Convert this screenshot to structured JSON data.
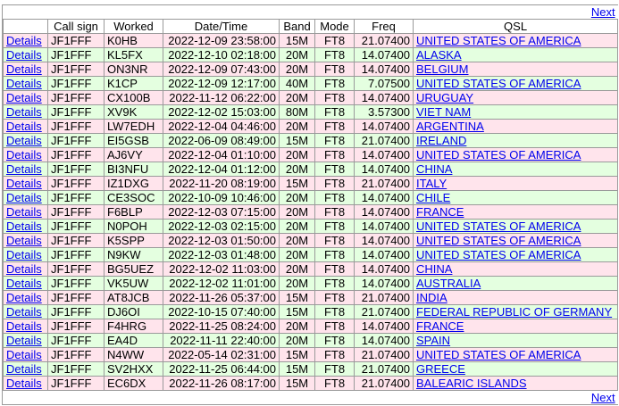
{
  "nav": {
    "next_label": "Next"
  },
  "columns": [
    "",
    "Call sign",
    "Worked",
    "Date/Time",
    "Band",
    "Mode",
    "Freq",
    "QSL"
  ],
  "details_label": "Details",
  "rows": [
    {
      "call": "JF1FFF",
      "worked": "K0HB",
      "datetime": "2022-12-09 23:58:00",
      "band": "15M",
      "mode": "FT8",
      "freq": "21.07400",
      "qsl": "UNITED STATES OF AMERICA"
    },
    {
      "call": "JF1FFF",
      "worked": "KL5FX",
      "datetime": "2022-12-10 02:18:00",
      "band": "20M",
      "mode": "FT8",
      "freq": "14.07400",
      "qsl": "ALASKA"
    },
    {
      "call": "JF1FFF",
      "worked": "ON3NR",
      "datetime": "2022-12-09 07:43:00",
      "band": "20M",
      "mode": "FT8",
      "freq": "14.07400",
      "qsl": "BELGIUM"
    },
    {
      "call": "JF1FFF",
      "worked": "K1CP",
      "datetime": "2022-12-09 12:17:00",
      "band": "40M",
      "mode": "FT8",
      "freq": "7.07500",
      "qsl": "UNITED STATES OF AMERICA"
    },
    {
      "call": "JF1FFF",
      "worked": "CX100B",
      "datetime": "2022-11-12 06:22:00",
      "band": "20M",
      "mode": "FT8",
      "freq": "14.07400",
      "qsl": "URUGUAY"
    },
    {
      "call": "JF1FFF",
      "worked": "XV9K",
      "datetime": "2022-12-02 15:03:00",
      "band": "80M",
      "mode": "FT8",
      "freq": "3.57300",
      "qsl": "VIET NAM"
    },
    {
      "call": "JF1FFF",
      "worked": "LW7EDH",
      "datetime": "2022-12-04 04:46:00",
      "band": "20M",
      "mode": "FT8",
      "freq": "14.07400",
      "qsl": "ARGENTINA"
    },
    {
      "call": "JF1FFF",
      "worked": "EI5GSB",
      "datetime": "2022-06-09 08:49:00",
      "band": "15M",
      "mode": "FT8",
      "freq": "21.07400",
      "qsl": "IRELAND"
    },
    {
      "call": "JF1FFF",
      "worked": "AJ6VY",
      "datetime": "2022-12-04 01:10:00",
      "band": "20M",
      "mode": "FT8",
      "freq": "14.07400",
      "qsl": "UNITED STATES OF AMERICA"
    },
    {
      "call": "JF1FFF",
      "worked": "BI3NFU",
      "datetime": "2022-12-04 01:12:00",
      "band": "20M",
      "mode": "FT8",
      "freq": "14.07400",
      "qsl": "CHINA"
    },
    {
      "call": "JF1FFF",
      "worked": "IZ1DXG",
      "datetime": "2022-11-20 08:19:00",
      "band": "15M",
      "mode": "FT8",
      "freq": "21.07400",
      "qsl": "ITALY"
    },
    {
      "call": "JF1FFF",
      "worked": "CE3SOC",
      "datetime": "2022-10-09 10:46:00",
      "band": "20M",
      "mode": "FT8",
      "freq": "14.07400",
      "qsl": "CHILE"
    },
    {
      "call": "JF1FFF",
      "worked": "F6BLP",
      "datetime": "2022-12-03 07:15:00",
      "band": "20M",
      "mode": "FT8",
      "freq": "14.07400",
      "qsl": "FRANCE"
    },
    {
      "call": "JF1FFF",
      "worked": "N0POH",
      "datetime": "2022-12-03 02:15:00",
      "band": "20M",
      "mode": "FT8",
      "freq": "14.07400",
      "qsl": "UNITED STATES OF AMERICA"
    },
    {
      "call": "JF1FFF",
      "worked": "K5SPP",
      "datetime": "2022-12-03 01:50:00",
      "band": "20M",
      "mode": "FT8",
      "freq": "14.07400",
      "qsl": "UNITED STATES OF AMERICA"
    },
    {
      "call": "JF1FFF",
      "worked": "N9KW",
      "datetime": "2022-12-03 01:48:00",
      "band": "20M",
      "mode": "FT8",
      "freq": "14.07400",
      "qsl": "UNITED STATES OF AMERICA"
    },
    {
      "call": "JF1FFF",
      "worked": "BG5UEZ",
      "datetime": "2022-12-02 11:03:00",
      "band": "20M",
      "mode": "FT8",
      "freq": "14.07400",
      "qsl": "CHINA"
    },
    {
      "call": "JF1FFF",
      "worked": "VK5UW",
      "datetime": "2022-12-02 11:01:00",
      "band": "20M",
      "mode": "FT8",
      "freq": "14.07400",
      "qsl": "AUSTRALIA"
    },
    {
      "call": "JF1FFF",
      "worked": "AT8JCB",
      "datetime": "2022-11-26 05:37:00",
      "band": "15M",
      "mode": "FT8",
      "freq": "21.07400",
      "qsl": "INDIA"
    },
    {
      "call": "JF1FFF",
      "worked": "DJ6OI",
      "datetime": "2022-10-15 07:40:00",
      "band": "15M",
      "mode": "FT8",
      "freq": "21.07400",
      "qsl": "FEDERAL REPUBLIC OF GERMANY"
    },
    {
      "call": "JF1FFF",
      "worked": "F4HRG",
      "datetime": "2022-11-25 08:24:00",
      "band": "20M",
      "mode": "FT8",
      "freq": "14.07400",
      "qsl": "FRANCE"
    },
    {
      "call": "JF1FFF",
      "worked": "EA4D",
      "datetime": "2022-11-11 22:40:00",
      "band": "20M",
      "mode": "FT8",
      "freq": "14.07400",
      "qsl": "SPAIN"
    },
    {
      "call": "JF1FFF",
      "worked": "N4WW",
      "datetime": "2022-05-14 02:31:00",
      "band": "15M",
      "mode": "FT8",
      "freq": "21.07400",
      "qsl": "UNITED STATES OF AMERICA"
    },
    {
      "call": "JF1FFF",
      "worked": "SV2HXX",
      "datetime": "2022-11-25 06:44:00",
      "band": "15M",
      "mode": "FT8",
      "freq": "21.07400",
      "qsl": "GREECE"
    },
    {
      "call": "JF1FFF",
      "worked": "EC6DX",
      "datetime": "2022-11-26 08:17:00",
      "band": "15M",
      "mode": "FT8",
      "freq": "21.07400",
      "qsl": "BALEARIC ISLANDS"
    }
  ],
  "colors": {
    "row_a": "#ffe4ec",
    "row_b": "#e4ffe0",
    "link": "#0000ee",
    "border": "#9a9a9a"
  }
}
